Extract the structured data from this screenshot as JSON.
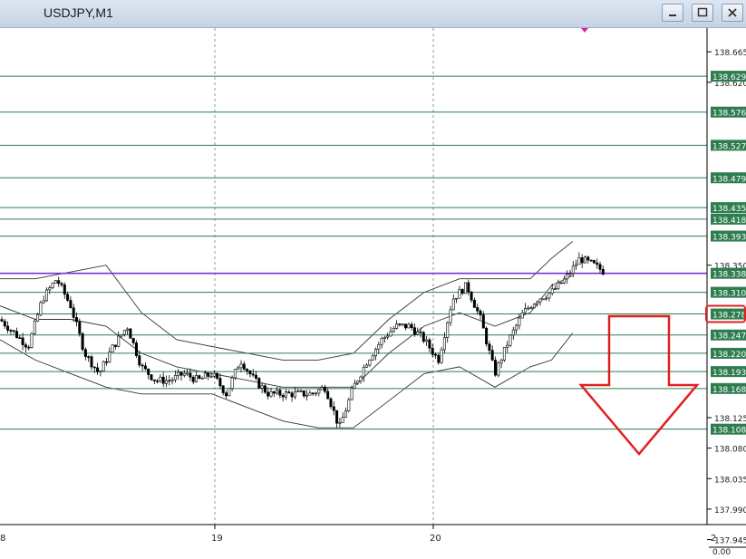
{
  "window": {
    "title": "USDJPY,M1"
  },
  "colors": {
    "level_line": "#2e7d4f",
    "level_label_bg": "#2e7d4f",
    "highlight_line": "#7b2fd6",
    "highlight_box": "#e02020",
    "arrow": "#e02020",
    "marker": "#e0209a"
  },
  "icons": [
    "minimize-icon",
    "restore-icon",
    "close-icon",
    "down-arrow-annotation",
    "price-marker-icon"
  ],
  "chart_data": {
    "type": "candlestick",
    "symbol": "USDJPY",
    "timeframe": "M1",
    "ylim": [
      137.955,
      138.7
    ],
    "price_ticks": [
      "138.665",
      "138.620",
      "138.350",
      "138.125",
      "138.080",
      "138.035",
      "137.990",
      "137.945"
    ],
    "time_ticks": [
      {
        "label": "19",
        "t": 0.3
      },
      {
        "label": "20",
        "t": 0.6
      }
    ],
    "corner_labels": {
      "left": "8",
      "right": "2",
      "indicator_value": "0.00"
    },
    "horizontal_levels": [
      {
        "label": "138.629",
        "value": 138.629
      },
      {
        "label": "138.576",
        "value": 138.576
      },
      {
        "label": "138.527",
        "value": 138.527
      },
      {
        "label": "138.479",
        "value": 138.479
      },
      {
        "label": "138.435",
        "value": 138.435
      },
      {
        "label": "138.418",
        "value": 138.418
      },
      {
        "label": "138.393",
        "value": 138.393
      },
      {
        "label": "138.338",
        "value": 138.338,
        "highlight": true
      },
      {
        "label": "138.310",
        "value": 138.31
      },
      {
        "label": "138.278",
        "value": 138.278,
        "boxed": true
      },
      {
        "label": "138.247",
        "value": 138.247
      },
      {
        "label": "138.220",
        "value": 138.22
      },
      {
        "label": "138.193",
        "value": 138.193
      },
      {
        "label": "138.168",
        "value": 138.168
      },
      {
        "label": "138.108",
        "value": 138.108
      }
    ],
    "close_path": [
      [
        0.0,
        138.27
      ],
      [
        0.02,
        138.25
      ],
      [
        0.04,
        138.23
      ],
      [
        0.06,
        138.3
      ],
      [
        0.08,
        138.33
      ],
      [
        0.1,
        138.29
      ],
      [
        0.12,
        138.22
      ],
      [
        0.14,
        138.19
      ],
      [
        0.16,
        138.23
      ],
      [
        0.18,
        138.26
      ],
      [
        0.2,
        138.2
      ],
      [
        0.22,
        138.18
      ],
      [
        0.24,
        138.18
      ],
      [
        0.26,
        138.19
      ],
      [
        0.28,
        138.18
      ],
      [
        0.3,
        138.19
      ],
      [
        0.32,
        138.16
      ],
      [
        0.34,
        138.21
      ],
      [
        0.36,
        138.18
      ],
      [
        0.38,
        138.16
      ],
      [
        0.4,
        138.16
      ],
      [
        0.42,
        138.16
      ],
      [
        0.44,
        138.16
      ],
      [
        0.46,
        138.17
      ],
      [
        0.48,
        138.11
      ],
      [
        0.5,
        138.17
      ],
      [
        0.52,
        138.21
      ],
      [
        0.54,
        138.24
      ],
      [
        0.56,
        138.26
      ],
      [
        0.58,
        138.26
      ],
      [
        0.6,
        138.24
      ],
      [
        0.62,
        138.21
      ],
      [
        0.64,
        138.3
      ],
      [
        0.66,
        138.32
      ],
      [
        0.68,
        138.27
      ],
      [
        0.7,
        138.19
      ],
      [
        0.72,
        138.24
      ],
      [
        0.74,
        138.28
      ],
      [
        0.76,
        138.3
      ],
      [
        0.78,
        138.31
      ],
      [
        0.8,
        138.33
      ],
      [
        0.82,
        138.36
      ],
      [
        0.84,
        138.35
      ],
      [
        0.855,
        138.34
      ]
    ],
    "bollinger": {
      "upper": [
        [
          0.0,
          138.33
        ],
        [
          0.05,
          138.33
        ],
        [
          0.1,
          138.34
        ],
        [
          0.15,
          138.35
        ],
        [
          0.2,
          138.28
        ],
        [
          0.25,
          138.24
        ],
        [
          0.3,
          138.23
        ],
        [
          0.35,
          138.22
        ],
        [
          0.4,
          138.21
        ],
        [
          0.45,
          138.21
        ],
        [
          0.5,
          138.22
        ],
        [
          0.55,
          138.27
        ],
        [
          0.6,
          138.31
        ],
        [
          0.65,
          138.33
        ],
        [
          0.7,
          138.33
        ],
        [
          0.75,
          138.33
        ],
        [
          0.78,
          138.36
        ],
        [
          0.81,
          138.385
        ]
      ],
      "middle": [
        [
          0.0,
          138.29
        ],
        [
          0.05,
          138.27
        ],
        [
          0.1,
          138.27
        ],
        [
          0.15,
          138.26
        ],
        [
          0.2,
          138.22
        ],
        [
          0.25,
          138.2
        ],
        [
          0.3,
          138.19
        ],
        [
          0.35,
          138.18
        ],
        [
          0.4,
          138.17
        ],
        [
          0.45,
          138.17
        ],
        [
          0.5,
          138.17
        ],
        [
          0.55,
          138.22
        ],
        [
          0.6,
          138.26
        ],
        [
          0.65,
          138.28
        ],
        [
          0.7,
          138.26
        ],
        [
          0.75,
          138.28
        ],
        [
          0.78,
          138.32
        ],
        [
          0.81,
          138.335
        ]
      ],
      "lower": [
        [
          0.0,
          138.24
        ],
        [
          0.05,
          138.21
        ],
        [
          0.1,
          138.19
        ],
        [
          0.15,
          138.17
        ],
        [
          0.2,
          138.16
        ],
        [
          0.25,
          138.16
        ],
        [
          0.3,
          138.16
        ],
        [
          0.35,
          138.14
        ],
        [
          0.4,
          138.12
        ],
        [
          0.45,
          138.11
        ],
        [
          0.5,
          138.11
        ],
        [
          0.55,
          138.15
        ],
        [
          0.6,
          138.19
        ],
        [
          0.65,
          138.2
        ],
        [
          0.7,
          138.17
        ],
        [
          0.75,
          138.2
        ],
        [
          0.78,
          138.21
        ],
        [
          0.81,
          138.25
        ]
      ]
    },
    "annotations": {
      "down_arrow": true,
      "top_marker": true
    }
  }
}
